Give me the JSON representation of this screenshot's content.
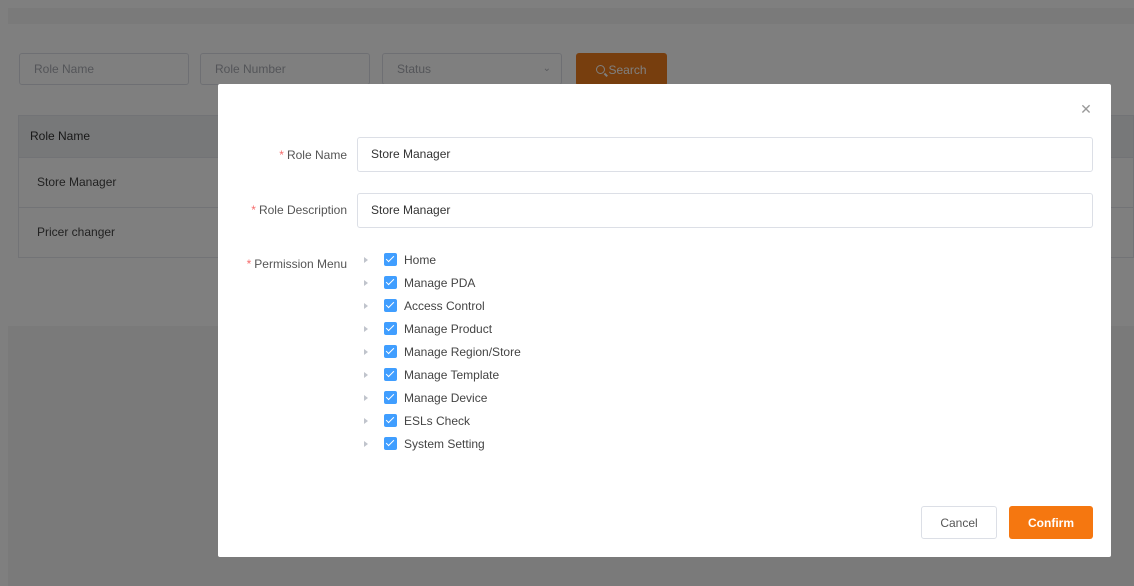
{
  "filters": {
    "role_name_placeholder": "Role Name",
    "role_number_placeholder": "Role Number",
    "status_placeholder": "Status",
    "search_label": "Search"
  },
  "table": {
    "columns": [
      "Role Name"
    ],
    "rows": [
      {
        "role_name": "Store Manager"
      },
      {
        "role_name": "Pricer changer"
      }
    ]
  },
  "dialog": {
    "close_icon": "close-icon",
    "required_mark": "*",
    "role_name_label": "Role Name",
    "role_name_value": "Store Manager",
    "role_description_label": "Role Description",
    "role_description_value": "Store Manager",
    "permission_menu_label": "Permission Menu",
    "permissions": [
      {
        "label": "Home",
        "checked": true
      },
      {
        "label": "Manage PDA",
        "checked": true
      },
      {
        "label": "Access Control",
        "checked": true
      },
      {
        "label": "Manage Product",
        "checked": true
      },
      {
        "label": "Manage Region/Store",
        "checked": true
      },
      {
        "label": "Manage Template",
        "checked": true
      },
      {
        "label": "Manage Device",
        "checked": true
      },
      {
        "label": "ESLs Check",
        "checked": true
      },
      {
        "label": "System Setting",
        "checked": true
      }
    ],
    "cancel_label": "Cancel",
    "confirm_label": "Confirm"
  },
  "colors": {
    "accent": "#f57710",
    "checkbox": "#409eff",
    "required": "#f56c6c"
  }
}
